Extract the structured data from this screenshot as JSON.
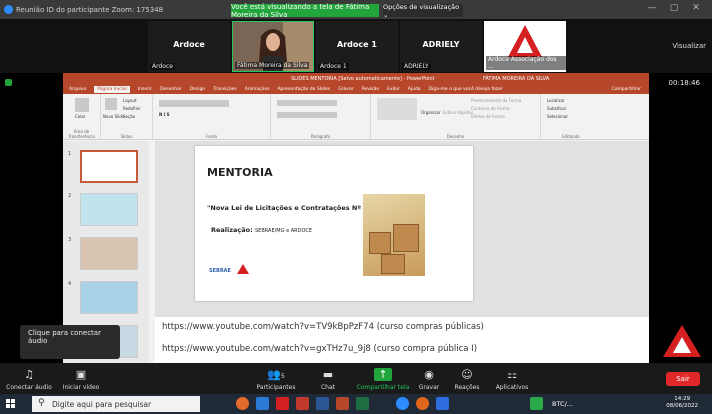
{
  "zoom": {
    "window_title": "Reunião ID do participante Zoom: 175348",
    "share_banner": "Você está visualizando a tela de Fátima Moreira da Silva",
    "view_options": "Opções de visualização ⌄",
    "visualizar": "Visualizar",
    "timer": "00:18:46"
  },
  "participants": [
    {
      "name": "Ardoce",
      "label": "Ardoce"
    },
    {
      "name": "",
      "label": "Fátima Moreira da Silva"
    },
    {
      "name": "Ardoce 1",
      "label": "Ardoce 1"
    },
    {
      "name": "ADRIELY",
      "label": "ADRIELY"
    },
    {
      "name": "",
      "label": "Ardoce Associação dos ..."
    }
  ],
  "ppt": {
    "doc_title": "SLIDES MENTORIA [Salvo automaticamente] - PowerPoint",
    "user": "FÁTIMA MOREIRA DA SILVA",
    "tabs": [
      "Arquivo",
      "Página Inicial",
      "Inserir",
      "Desenhar",
      "Design",
      "Transições",
      "Animações",
      "Apresentação de Slides",
      "Gravar",
      "Revisão",
      "Exibir",
      "Ajuda",
      "Diga-me o que você deseja fazer"
    ],
    "share_label": "Compartilhar",
    "groups": [
      "Área de Transferência",
      "Slides",
      "Fonte",
      "Parágrafo",
      "Desenho",
      "Editando"
    ],
    "buttons": {
      "colar": "Colar",
      "novo_slide": "Novo Slide",
      "layout": "Layout",
      "redefinir": "Redefinir",
      "secao": "Seção",
      "organizar": "Organizar",
      "estilos": "Estilos Rápidos",
      "preenchimento": "Preenchimento da Forma",
      "contorno": "Contorno da Forma",
      "efeitos": "Efeitos de Forma",
      "localizar": "Localizar",
      "substituir": "Substituir",
      "selecionar": "Selecionar"
    },
    "thumb_numbers": [
      "1",
      "2",
      "3",
      "4",
      "5"
    ]
  },
  "slide": {
    "title": "MENTORIA",
    "subtitle": "\"Nova Lei de Licitações e Contratações Nº 14.133/2021\"",
    "realizacao_label": "Realização:",
    "realizacao_org": "SEBRAE/MG e ARDOCE",
    "sebrae": "SEBRAE"
  },
  "notes": [
    "https://www.youtube.com/watch?v=TV9kBpPzF74 (curso compras públicas)",
    "https://www.youtube.com/watch?v=gxTHz7u_9j8 (curso compra pública I)"
  ],
  "tooltip": "Clique para conectar áudio",
  "toolbar": {
    "audio": "Conectar áudio",
    "video": "Iniciar vídeo",
    "participants": "Participantes",
    "participants_count": "5",
    "chat": "Chat",
    "share": "Compartilhar tela",
    "record": "Gravar",
    "reactions": "Reações",
    "apps": "Aplicativos",
    "leave": "Sair"
  },
  "taskbar": {
    "search_placeholder": "Digite aqui para pesquisar",
    "btc": "BTC/...",
    "time": "14:29",
    "date": "08/06/2022"
  },
  "colors": {
    "ppt_accent": "#b7472a",
    "share_green": "#22a53b",
    "leave_red": "#e02828",
    "taskbar": "#202a37"
  }
}
